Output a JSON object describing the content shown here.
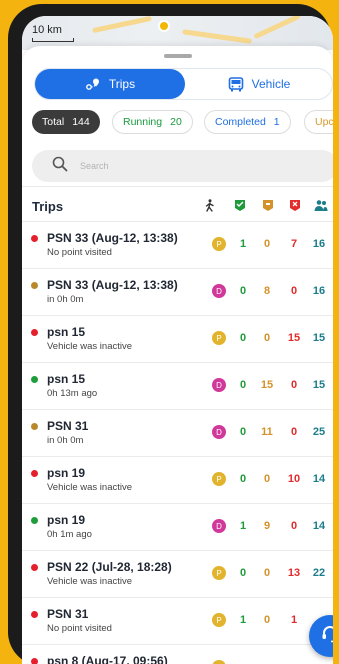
{
  "map": {
    "scale_label": "10 km"
  },
  "tabs": [
    {
      "label": "Trips",
      "active": true
    },
    {
      "label": "Vehicle",
      "active": false
    }
  ],
  "filters": {
    "total": {
      "label": "Total",
      "count": "144"
    },
    "running": {
      "label": "Running",
      "count": "20"
    },
    "completed": {
      "label": "Completed",
      "count": "1"
    },
    "upcoming": {
      "label": "Upcon"
    }
  },
  "search": {
    "placeholder": "Search"
  },
  "list": {
    "title": "Trips",
    "column_icons": [
      "walking-person-icon",
      "green-check-flag-icon",
      "orange-flag-icon",
      "red-flag-icon",
      "people-icon"
    ]
  },
  "colors": {
    "accent": "#1f6fe5",
    "status_red": "#e4202c",
    "status_green": "#1e9e3a",
    "status_brown": "#b8892c",
    "badge_p": "#e2b32c",
    "badge_d": "#d0389a"
  },
  "trips": [
    {
      "name": "PSN 33 (Aug-12, 13:38)",
      "sub": "No point visited",
      "status": "red",
      "badge": "P",
      "v1": "1",
      "v2": "0",
      "v3": "7",
      "v4": "16"
    },
    {
      "name": "PSN 33 (Aug-12, 13:38)",
      "sub": "in 0h 0m",
      "status": "brown",
      "badge": "D",
      "v1": "0",
      "v2": "8",
      "v3": "0",
      "v4": "16"
    },
    {
      "name": "psn 15",
      "sub": "Vehicle was inactive",
      "status": "red",
      "badge": "P",
      "v1": "0",
      "v2": "0",
      "v3": "15",
      "v4": "15"
    },
    {
      "name": "psn 15",
      "sub": "0h 13m ago",
      "status": "green",
      "badge": "D",
      "v1": "0",
      "v2": "15",
      "v3": "0",
      "v4": "15"
    },
    {
      "name": "PSN 31",
      "sub": "in 0h 0m",
      "status": "brown",
      "badge": "D",
      "v1": "0",
      "v2": "11",
      "v3": "0",
      "v4": "25"
    },
    {
      "name": "psn 19",
      "sub": "Vehicle was inactive",
      "status": "red",
      "badge": "P",
      "v1": "0",
      "v2": "0",
      "v3": "10",
      "v4": "14"
    },
    {
      "name": "psn 19",
      "sub": "0h 1m ago",
      "status": "green",
      "badge": "D",
      "v1": "1",
      "v2": "9",
      "v3": "0",
      "v4": "14"
    },
    {
      "name": "PSN 22 (Jul-28, 18:28)",
      "sub": "Vehicle was inactive",
      "status": "red",
      "badge": "P",
      "v1": "0",
      "v2": "0",
      "v3": "13",
      "v4": "22"
    },
    {
      "name": "PSN 31",
      "sub": "No point visited",
      "status": "red",
      "badge": "P",
      "v1": "1",
      "v2": "0",
      "v3": "1",
      "v4": ""
    },
    {
      "name": "psn 8 (Aug-17, 09:56)",
      "sub": "",
      "status": "red",
      "badge": "P",
      "v1": "",
      "v2": "",
      "v3": "",
      "v4": ""
    }
  ]
}
